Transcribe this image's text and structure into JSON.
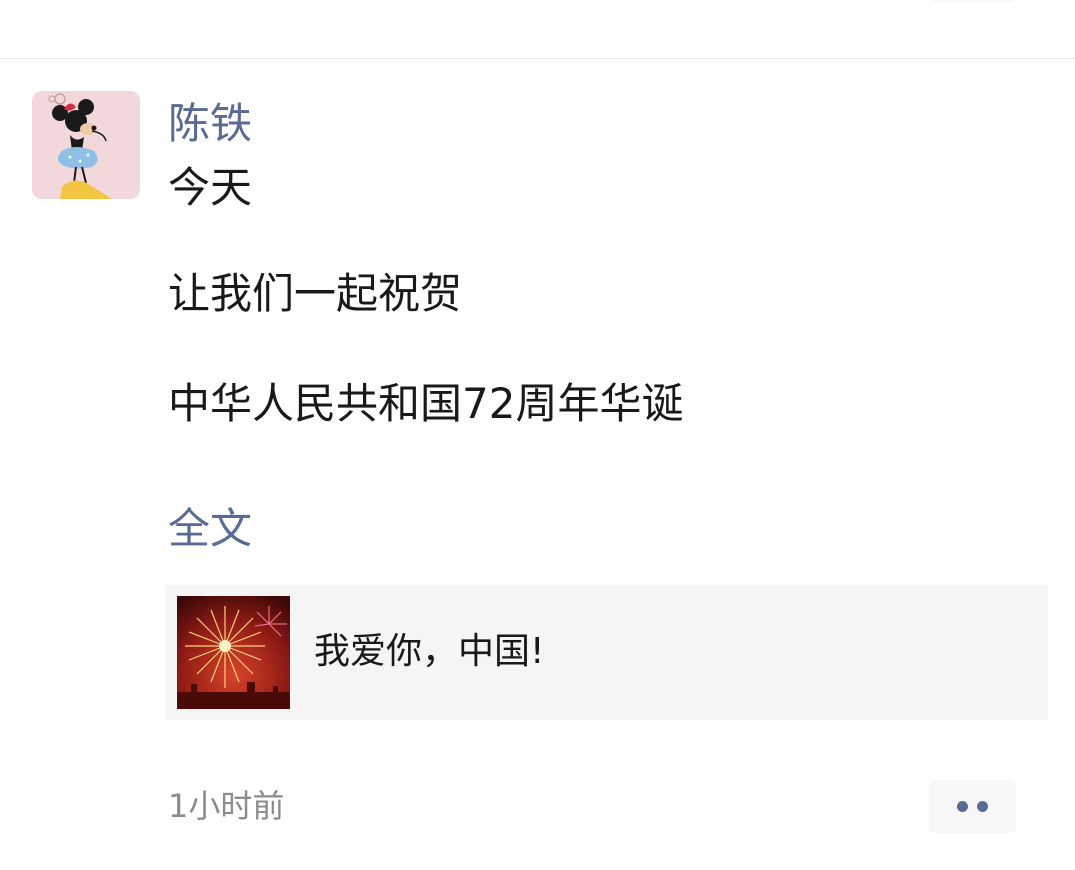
{
  "post": {
    "author": "陈铁",
    "text_lines": [
      "今天",
      "让我们一起祝贺",
      "中华人民共和国72周年华诞"
    ],
    "expand_label": "全文",
    "link_card": {
      "title": "我爱你，中国!"
    },
    "timestamp": "1小时前"
  },
  "icons": {
    "avatar": "minnie-mouse-avatar-icon",
    "thumbnail": "fireworks-thumbnail-icon",
    "more": "more-dots-icon"
  },
  "colors": {
    "link_blue": "#576b95",
    "text": "#191919",
    "muted": "#8c8c8c",
    "card_bg": "#f5f5f5"
  }
}
